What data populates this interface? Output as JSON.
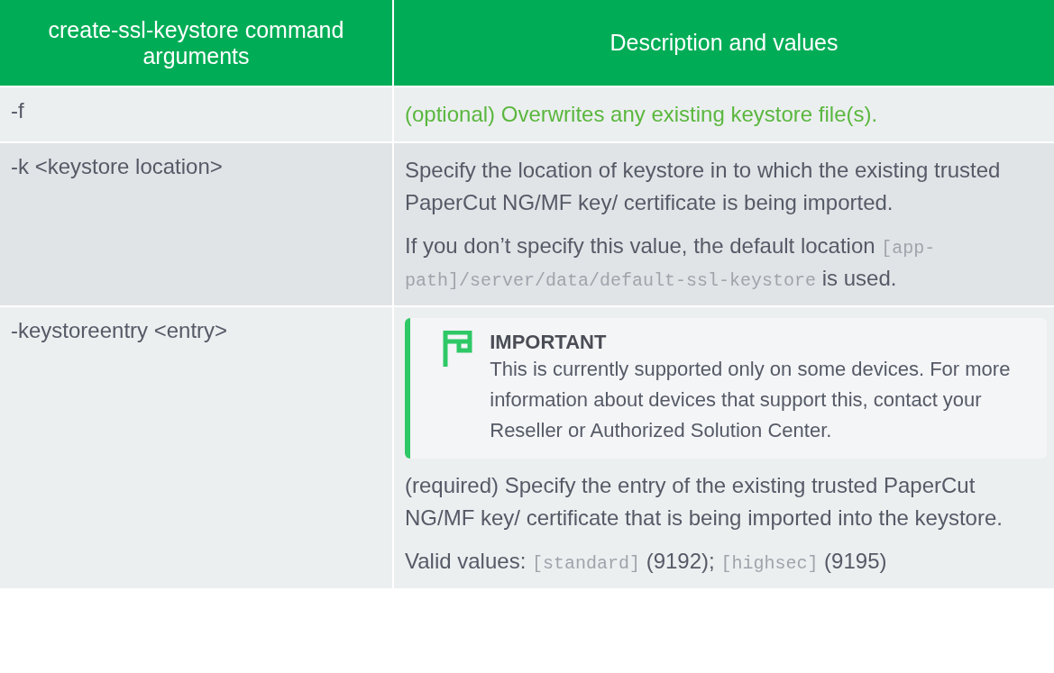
{
  "table": {
    "columns": [
      "create-ssl-keystore command arguments",
      "Description and values"
    ],
    "rows": [
      {
        "argument": "-f",
        "content": [
          {
            "kind": "paragraph",
            "emphasis": true,
            "parts": [
              {
                "kind": "text",
                "text": "(optional) Overwrites any existing keystore file(s)."
              }
            ]
          }
        ]
      },
      {
        "argument": "-k <keystore location>",
        "content": [
          {
            "kind": "paragraph",
            "emphasis": false,
            "parts": [
              {
                "kind": "text",
                "text": "Specify the location of keystore in to which the existing trusted PaperCut NG/MF key/ certificate is being imported."
              }
            ]
          },
          {
            "kind": "paragraph",
            "emphasis": false,
            "parts": [
              {
                "kind": "text",
                "text": "If you don’t specify this value, the default location "
              },
              {
                "kind": "code",
                "text": "[app-path]/server/data/default-ssl-keystore"
              },
              {
                "kind": "text",
                "text": " is used."
              }
            ]
          }
        ]
      },
      {
        "argument": "-keystoreentry <entry>",
        "content": [
          {
            "kind": "callout",
            "title": "IMPORTANT",
            "body": "This is currently supported only on some devices. For more information about devices that support this, contact your Reseller or Authorized Solution Center."
          },
          {
            "kind": "paragraph",
            "emphasis": false,
            "parts": [
              {
                "kind": "text",
                "text": "(required) Specify the entry of the existing trusted PaperCut NG/MF key/ certificate that is being imported into the keystore."
              }
            ]
          },
          {
            "kind": "paragraph",
            "emphasis": false,
            "parts": [
              {
                "kind": "text",
                "text": "Valid values: "
              },
              {
                "kind": "code",
                "text": "[standard]"
              },
              {
                "kind": "text",
                "text": " (9192); "
              },
              {
                "kind": "code",
                "text": "[highsec]"
              },
              {
                "kind": "text",
                "text": " (9195)"
              }
            ]
          }
        ]
      }
    ]
  }
}
